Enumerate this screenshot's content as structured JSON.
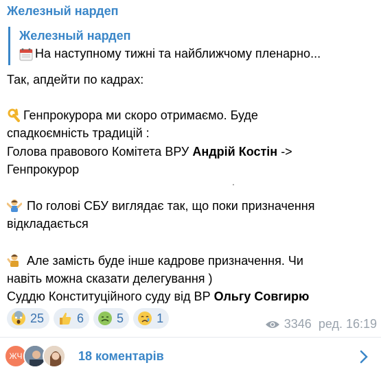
{
  "channel": {
    "name": "Железный нардеп"
  },
  "reply": {
    "author": "Железный нардеп",
    "icon": "calendar-icon",
    "text": "На наступному тижні та найближчому пленарно..."
  },
  "post": {
    "line1": "Так, апдейти по кадрах:",
    "para1_emoji": "ok-hand-icon",
    "para1_l1": "Генпрокурора ми скоро отримаємо. Буде",
    "para1_l2": "спадкоємність традицій :",
    "para1_l3_a": "Голова правового Комітета ВРУ ",
    "para1_l3_b": "Андрій Костін",
    "para1_l3_c": "  ->",
    "para1_l4": "Генпрокурор",
    "dot": ".",
    "para2_emoji": "shrug-icon",
    "para2_l1": " По голові СБУ виглядає так, що поки призначення",
    "para2_l2": "відкладається",
    "para3_emoji": "person-icon",
    "para3_l1": " Але замість буде інше кадрове призначення. Чи",
    "para3_l2": "навіть можна сказати делегування )",
    "para3_l3_a": "Суддю Конституційного суду від ВР ",
    "para3_l3_b": "Ольгу Совгирю"
  },
  "reactions": [
    {
      "icon": "scream-icon",
      "count": "25"
    },
    {
      "icon": "thumbs-up-icon",
      "count": "6"
    },
    {
      "icon": "nauseated-icon",
      "count": "5"
    },
    {
      "icon": "crying-icon",
      "count": "1"
    }
  ],
  "meta": {
    "views": "3346",
    "edited": "ред. 16:19"
  },
  "comments": {
    "avatar1_initials": "ЖЧ",
    "label": "18 коментарів"
  },
  "colors": {
    "accent": "#3a86c8",
    "reaction_bg": "#e8eef5",
    "meta": "#9aa3ad"
  }
}
